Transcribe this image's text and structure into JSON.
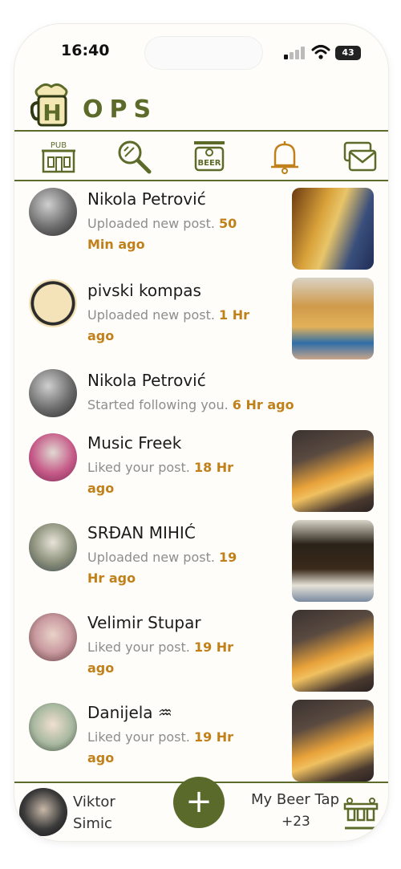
{
  "status": {
    "time": "16:40",
    "battery": "43"
  },
  "app": {
    "name": "HOPS"
  },
  "nav_icons": [
    "pub-icon",
    "search-icon",
    "beer-sign-icon",
    "bell-icon",
    "messages-icon"
  ],
  "nav_pub_text": "PUB",
  "nav_beer_text": "BEER",
  "feed": [
    {
      "name": "Nikola Petrović",
      "action": "Uploaded new post.",
      "time": "50 Min ago"
    },
    {
      "name": "pivski kompas",
      "action": "Uploaded new post.",
      "time": "1 Hr ago"
    },
    {
      "name": "Nikola Petrović",
      "action": "Started following you.",
      "time": "6 Hr ago"
    },
    {
      "name": "Music Freek",
      "action": "Liked your post.",
      "time": "18 Hr ago"
    },
    {
      "name": "SRĐAN MIHIĆ",
      "action": "Uploaded new post.",
      "time": "19 Hr ago"
    },
    {
      "name": "Velimir Stupar",
      "action": "Liked your post.",
      "time": "19 Hr ago"
    },
    {
      "name": "Danijela ♒",
      "action": "Liked your post.",
      "time": "19 Hr ago"
    }
  ],
  "bottom": {
    "user_name": "Viktor Simic",
    "add_label": "+",
    "tap_label": "My Beer Tap",
    "tap_count": "+23"
  },
  "colors": {
    "accent": "#5d6b2a",
    "time_text": "#c0801a",
    "muted": "#8d8d8d"
  }
}
